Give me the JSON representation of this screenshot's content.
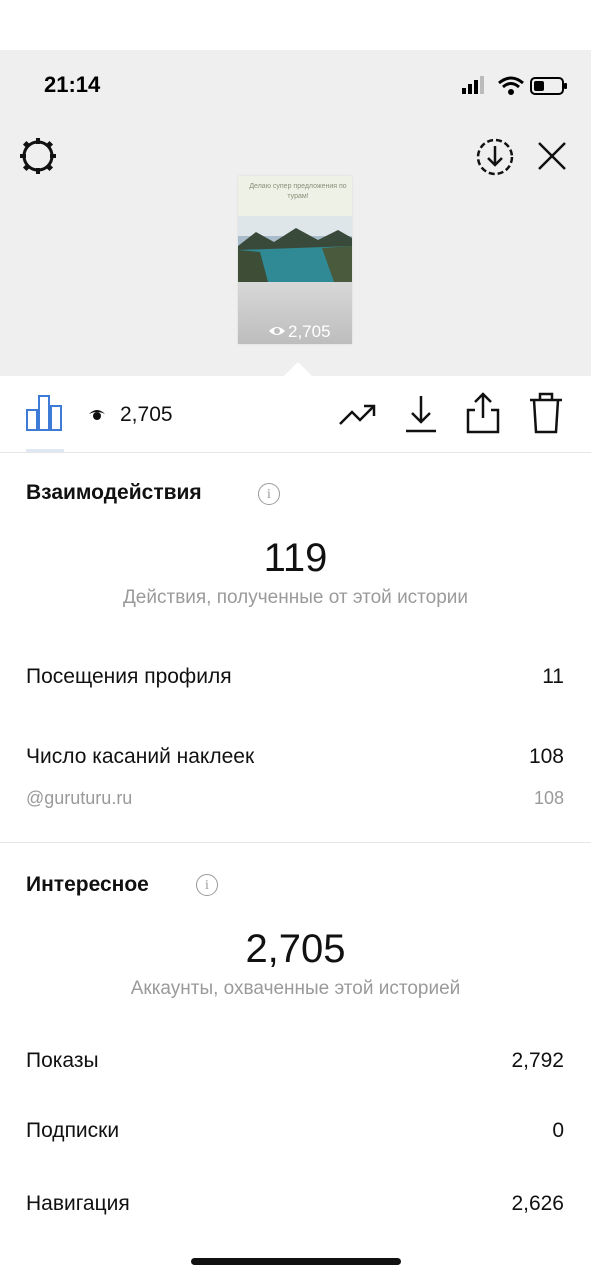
{
  "status_bar": {
    "time": "21:14"
  },
  "story": {
    "banner_text": "Делаю супер предложения по турам!",
    "views": "2,705"
  },
  "toolbar": {
    "views": "2,705"
  },
  "interactions": {
    "title": "Взаимодействия",
    "info_glyph": "i",
    "total": "119",
    "caption": "Действия, полученные от этой истории",
    "rows": [
      {
        "label": "Посещения профиля",
        "value": "11"
      },
      {
        "label": "Число касаний наклеек",
        "value": "108"
      }
    ],
    "sticker": {
      "label": "@guruturu.ru",
      "value": "108"
    }
  },
  "discovery": {
    "title": "Интересное",
    "info_glyph": "i",
    "total": "2,705",
    "caption": "Аккаунты, охваченные этой историей",
    "rows": [
      {
        "label": "Показы",
        "value": "2,792"
      },
      {
        "label": "Подписки",
        "value": "0"
      },
      {
        "label": "Навигация",
        "value": "2,626"
      }
    ]
  },
  "icons": [
    "signal-icon",
    "wifi-icon",
    "battery-icon",
    "settings-gear-icon",
    "download-circle-icon",
    "close-icon",
    "eye-icon",
    "bar-chart-icon",
    "trend-icon",
    "download-icon",
    "share-icon",
    "trash-icon",
    "info-icon"
  ],
  "colors": {
    "accent_blue": "#3d7bd6",
    "hero_bg": "#efefef",
    "muted_text": "#9a9a9a"
  }
}
